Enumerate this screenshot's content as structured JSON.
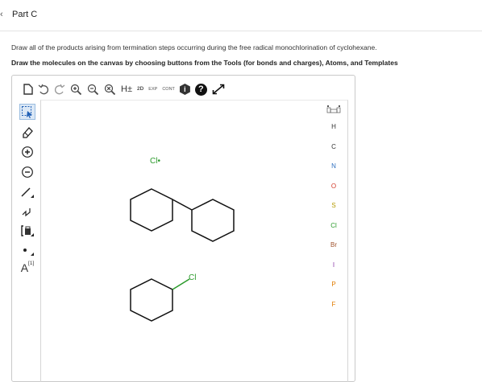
{
  "part": {
    "caret": "‹",
    "title": "Part C"
  },
  "instructions": {
    "line1": "Draw all of the products arising from termination steps occurring during the free radical monochlorination of cyclohexane.",
    "line2": "Draw the molecules on the canvas by choosing buttons from the Tools (for bonds and charges), Atoms, and Templates"
  },
  "toolbar": {
    "h_plus": "H±",
    "twod_label": "2D",
    "exp_label": "EXP",
    "cont_label": "CONT",
    "info_glyph": "i",
    "help_glyph": "?"
  },
  "left_tools": {
    "template_label": "A",
    "template_sup": "[1]"
  },
  "atoms": [
    "H",
    "C",
    "N",
    "O",
    "S",
    "Cl",
    "Br",
    "I",
    "P",
    "F"
  ],
  "atom_colors": {
    "H": "#333333",
    "C": "#333333",
    "N": "#2f6fc0",
    "O": "#d23b2a",
    "S": "#b59a00",
    "Cl": "#2a9a2a",
    "Br": "#a0522d",
    "I": "#8b3aa8",
    "P": "#e07b00",
    "F": "#e07b00"
  },
  "canvas": {
    "radical_label": "Cl•",
    "chloro_label": "Cl",
    "label_color": "#2a9a2a"
  }
}
